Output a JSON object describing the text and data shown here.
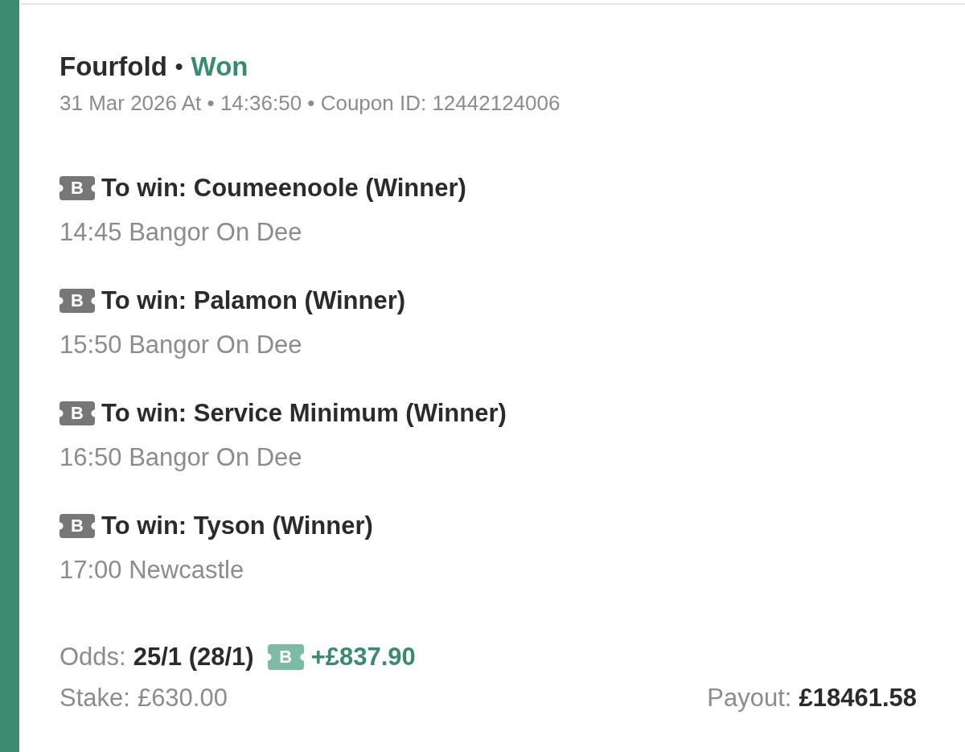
{
  "bet": {
    "type": "Fourfold",
    "separator": "•",
    "status": {
      "label": "Won",
      "kind": "won"
    },
    "meta": "31 Mar 2026 At • 14:36:50 • Coupon ID: 12442124006"
  },
  "legs": [
    {
      "badge": "B",
      "selection": "To win: Coumeenoole (Winner)",
      "event": "14:45 Bangor On Dee"
    },
    {
      "badge": "B",
      "selection": "To win: Palamon (Winner)",
      "event": "15:50 Bangor On Dee"
    },
    {
      "badge": "B",
      "selection": "To win: Service Minimum (Winner)",
      "event": "16:50 Bangor On Dee"
    },
    {
      "badge": "B",
      "selection": "To win: Tyson (Winner)",
      "event": "17:00 Newcastle"
    }
  ],
  "summary": {
    "odds": {
      "label": "Odds:",
      "value": "25/1 (28/1)",
      "badge": "B",
      "boost": "+£837.90"
    },
    "stake": {
      "label": "Stake:",
      "value": "£630.00"
    },
    "payout": {
      "label": "Payout:",
      "value": "£18461.58"
    }
  }
}
